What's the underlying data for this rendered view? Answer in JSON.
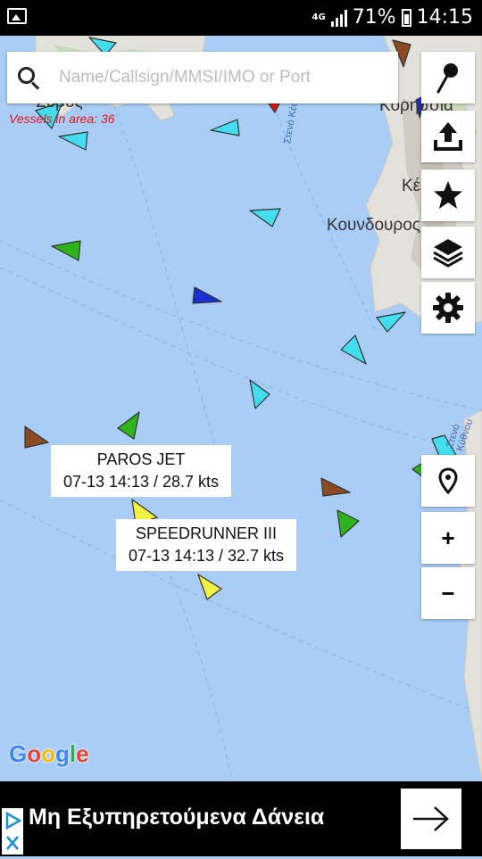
{
  "status_bar": {
    "network": "4G",
    "battery": "71%",
    "time": "14:15"
  },
  "search": {
    "placeholder": "Name/Callsign/MMSI/IMO or Port"
  },
  "vessels_in_area": "Vessels in area: 36",
  "map": {
    "places": [
      "Σύρος",
      "Κορησσία",
      "Κέα",
      "Κουνδουρος"
    ],
    "straits": [
      "Στενό Κέας",
      "Στενό Κύθνου"
    ],
    "colors": {
      "sea": "#a9cdf4",
      "land": "#e3e1dc",
      "cargo_green": "#2db31c",
      "passenger_cyan": "#44dded",
      "highspeed_yellow": "#f4f240",
      "tanker_brown": "#8a4a22",
      "tug_blue": "#1a2fd6",
      "special_red": "#e21414"
    }
  },
  "labels": [
    {
      "name": "PAROS JET",
      "info": "07-13 14:13 / 28.7 kts"
    },
    {
      "name": "SPEEDRUNNER III",
      "info": "07-13 14:13 / 32.7 kts"
    }
  ],
  "toolbar_icons": [
    "pin-icon",
    "share-upload-icon",
    "star-icon",
    "layers-icon",
    "gear-icon"
  ],
  "map_controls": {
    "location_icon": "location-pin-icon",
    "zoom_in": "+",
    "zoom_out": "−"
  },
  "google_logo": "Google",
  "ad": {
    "title": "Μη Εξυπηρετούμενα Δάνεια"
  }
}
